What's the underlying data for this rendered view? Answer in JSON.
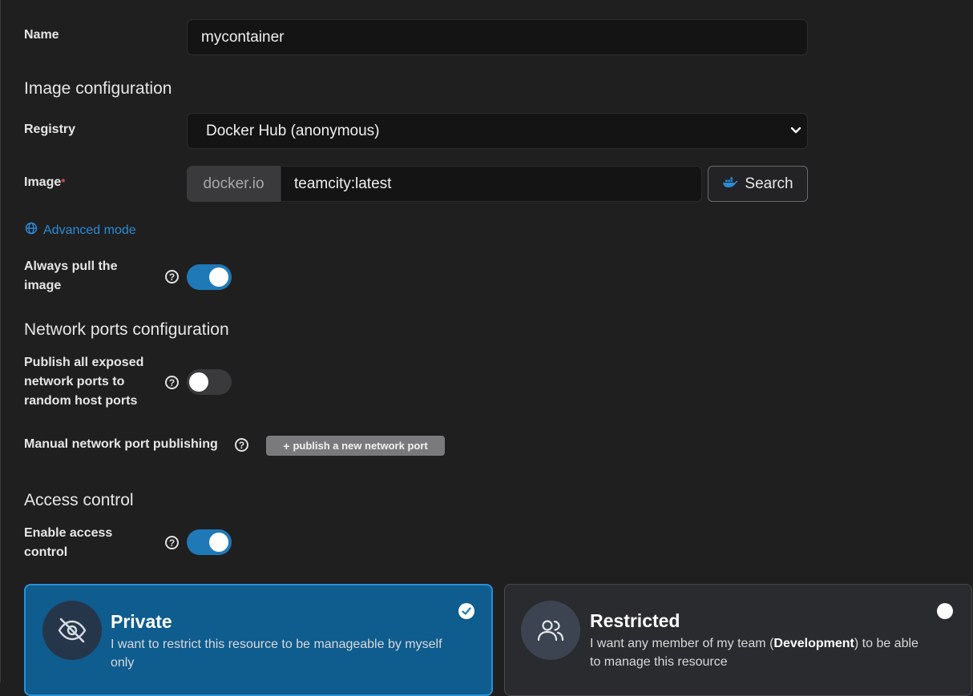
{
  "name": {
    "label": "Name",
    "value": "mycontainer"
  },
  "image_config": {
    "heading": "Image configuration",
    "registry_label": "Registry",
    "registry_value": "Docker Hub (anonymous)",
    "image_label": "Image",
    "required_marker": "*",
    "image_prefix": "docker.io",
    "image_value": "teamcity:latest",
    "search_label": "Search",
    "advanced_mode": "Advanced mode",
    "always_pull_label_line1": "Always pull the",
    "always_pull_label_line2": "image",
    "always_pull_on": true
  },
  "network": {
    "heading": "Network ports configuration",
    "publish_all_line1": "Publish all exposed",
    "publish_all_line2": "network ports to",
    "publish_all_line3": "random host ports",
    "publish_all_on": false,
    "manual_label": "Manual network port publishing",
    "publish_new_label": "publish a new network port"
  },
  "access": {
    "heading": "Access control",
    "enable_line1": "Enable access",
    "enable_line2": "control",
    "enable_on": true,
    "cards": [
      {
        "title": "Private",
        "desc_line1": "I want to restrict this resource to be manageable by myself",
        "desc_line2": "only",
        "selected": true
      },
      {
        "title": "Restricted",
        "desc_line1_a": "I want any member of my team (",
        "desc_line1_team": "Development",
        "desc_line1_b": ") to be able",
        "desc_line2": "to manage this resource",
        "selected": false
      }
    ]
  },
  "colors": {
    "accent": "#1f79b7",
    "link": "#2b8bd6",
    "required": "#d9534f",
    "selected_card": "#0f5c8e"
  },
  "icons": [
    "chevron-down-icon",
    "docker-whale-icon",
    "globe-icon",
    "help-icon",
    "plus-icon",
    "eye-slash-icon",
    "users-icon",
    "check-icon"
  ]
}
